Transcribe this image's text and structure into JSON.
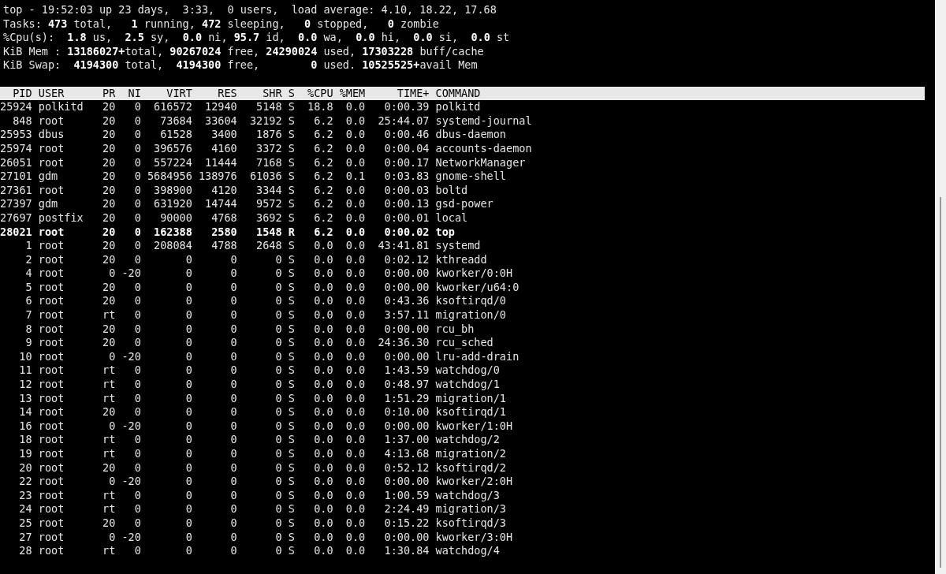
{
  "summary": [
    "top - 19:52:03 up 23 days,  3:33,  0 users,  load average: 4.10, 18.22, 17.68",
    "Tasks: **473** total,   **1** running, **472** sleeping,   **0** stopped,   **0** zombie",
    "%Cpu(s):  **1.8** us,  **2.5** sy,  **0.0** ni, **95.7** id,  **0.0** wa,  **0.0** hi,  **0.0** si,  **0.0** st",
    "KiB Mem : **13186027+**total, **90267024** free, **24290024** used, **17303228** buff/cache",
    "KiB Swap:  **4194300** total,  **4194300** free,        **0** used. **10525525+**avail Mem"
  ],
  "table": {
    "columns": [
      "PID",
      "USER",
      "PR",
      "NI",
      "VIRT",
      "RES",
      "SHR",
      "S",
      "%CPU",
      "%MEM",
      "TIME+",
      "COMMAND"
    ],
    "rows": [
      {
        "cells": [
          "25924",
          "polkitd",
          "20",
          "0",
          "616572",
          "12940",
          "5148",
          "S",
          "18.8",
          "0.0",
          "0:00.39",
          "polkitd"
        ],
        "highlighted": false
      },
      {
        "cells": [
          "848",
          "root",
          "20",
          "0",
          "73684",
          "33604",
          "32192",
          "S",
          "6.2",
          "0.0",
          "25:44.07",
          "systemd-journal"
        ],
        "highlighted": false
      },
      {
        "cells": [
          "25953",
          "dbus",
          "20",
          "0",
          "61528",
          "3400",
          "1876",
          "S",
          "6.2",
          "0.0",
          "0:00.46",
          "dbus-daemon"
        ],
        "highlighted": false
      },
      {
        "cells": [
          "25974",
          "root",
          "20",
          "0",
          "396576",
          "4160",
          "3372",
          "S",
          "6.2",
          "0.0",
          "0:00.04",
          "accounts-daemon"
        ],
        "highlighted": false
      },
      {
        "cells": [
          "26051",
          "root",
          "20",
          "0",
          "557224",
          "11444",
          "7168",
          "S",
          "6.2",
          "0.0",
          "0:00.17",
          "NetworkManager"
        ],
        "highlighted": false
      },
      {
        "cells": [
          "27101",
          "gdm",
          "20",
          "0",
          "5684956",
          "138976",
          "61036",
          "S",
          "6.2",
          "0.1",
          "0:03.83",
          "gnome-shell"
        ],
        "highlighted": false
      },
      {
        "cells": [
          "27361",
          "root",
          "20",
          "0",
          "398900",
          "4120",
          "3344",
          "S",
          "6.2",
          "0.0",
          "0:00.03",
          "boltd"
        ],
        "highlighted": false
      },
      {
        "cells": [
          "27397",
          "gdm",
          "20",
          "0",
          "631920",
          "14744",
          "9572",
          "S",
          "6.2",
          "0.0",
          "0:00.13",
          "gsd-power"
        ],
        "highlighted": false
      },
      {
        "cells": [
          "27697",
          "postfix",
          "20",
          "0",
          "90000",
          "4768",
          "3692",
          "S",
          "6.2",
          "0.0",
          "0:00.01",
          "local"
        ],
        "highlighted": false
      },
      {
        "cells": [
          "28021",
          "root",
          "20",
          "0",
          "162388",
          "2580",
          "1548",
          "R",
          "6.2",
          "0.0",
          "0:00.02",
          "top"
        ],
        "highlighted": true
      },
      {
        "cells": [
          "1",
          "root",
          "20",
          "0",
          "208084",
          "4788",
          "2648",
          "S",
          "0.0",
          "0.0",
          "43:41.81",
          "systemd"
        ],
        "highlighted": false
      },
      {
        "cells": [
          "2",
          "root",
          "20",
          "0",
          "0",
          "0",
          "0",
          "S",
          "0.0",
          "0.0",
          "0:02.12",
          "kthreadd"
        ],
        "highlighted": false
      },
      {
        "cells": [
          "4",
          "root",
          "0",
          "-20",
          "0",
          "0",
          "0",
          "S",
          "0.0",
          "0.0",
          "0:00.00",
          "kworker/0:0H"
        ],
        "highlighted": false
      },
      {
        "cells": [
          "5",
          "root",
          "20",
          "0",
          "0",
          "0",
          "0",
          "S",
          "0.0",
          "0.0",
          "0:00.00",
          "kworker/u64:0"
        ],
        "highlighted": false
      },
      {
        "cells": [
          "6",
          "root",
          "20",
          "0",
          "0",
          "0",
          "0",
          "S",
          "0.0",
          "0.0",
          "0:43.36",
          "ksoftirqd/0"
        ],
        "highlighted": false
      },
      {
        "cells": [
          "7",
          "root",
          "rt",
          "0",
          "0",
          "0",
          "0",
          "S",
          "0.0",
          "0.0",
          "3:57.11",
          "migration/0"
        ],
        "highlighted": false
      },
      {
        "cells": [
          "8",
          "root",
          "20",
          "0",
          "0",
          "0",
          "0",
          "S",
          "0.0",
          "0.0",
          "0:00.00",
          "rcu_bh"
        ],
        "highlighted": false
      },
      {
        "cells": [
          "9",
          "root",
          "20",
          "0",
          "0",
          "0",
          "0",
          "S",
          "0.0",
          "0.0",
          "24:36.30",
          "rcu_sched"
        ],
        "highlighted": false
      },
      {
        "cells": [
          "10",
          "root",
          "0",
          "-20",
          "0",
          "0",
          "0",
          "S",
          "0.0",
          "0.0",
          "0:00.00",
          "lru-add-drain"
        ],
        "highlighted": false
      },
      {
        "cells": [
          "11",
          "root",
          "rt",
          "0",
          "0",
          "0",
          "0",
          "S",
          "0.0",
          "0.0",
          "1:43.59",
          "watchdog/0"
        ],
        "highlighted": false
      },
      {
        "cells": [
          "12",
          "root",
          "rt",
          "0",
          "0",
          "0",
          "0",
          "S",
          "0.0",
          "0.0",
          "0:48.97",
          "watchdog/1"
        ],
        "highlighted": false
      },
      {
        "cells": [
          "13",
          "root",
          "rt",
          "0",
          "0",
          "0",
          "0",
          "S",
          "0.0",
          "0.0",
          "1:51.29",
          "migration/1"
        ],
        "highlighted": false
      },
      {
        "cells": [
          "14",
          "root",
          "20",
          "0",
          "0",
          "0",
          "0",
          "S",
          "0.0",
          "0.0",
          "0:10.00",
          "ksoftirqd/1"
        ],
        "highlighted": false
      },
      {
        "cells": [
          "16",
          "root",
          "0",
          "-20",
          "0",
          "0",
          "0",
          "S",
          "0.0",
          "0.0",
          "0:00.00",
          "kworker/1:0H"
        ],
        "highlighted": false
      },
      {
        "cells": [
          "18",
          "root",
          "rt",
          "0",
          "0",
          "0",
          "0",
          "S",
          "0.0",
          "0.0",
          "1:37.00",
          "watchdog/2"
        ],
        "highlighted": false
      },
      {
        "cells": [
          "19",
          "root",
          "rt",
          "0",
          "0",
          "0",
          "0",
          "S",
          "0.0",
          "0.0",
          "4:13.68",
          "migration/2"
        ],
        "highlighted": false
      },
      {
        "cells": [
          "20",
          "root",
          "20",
          "0",
          "0",
          "0",
          "0",
          "S",
          "0.0",
          "0.0",
          "0:52.12",
          "ksoftirqd/2"
        ],
        "highlighted": false
      },
      {
        "cells": [
          "22",
          "root",
          "0",
          "-20",
          "0",
          "0",
          "0",
          "S",
          "0.0",
          "0.0",
          "0:00.00",
          "kworker/2:0H"
        ],
        "highlighted": false
      },
      {
        "cells": [
          "23",
          "root",
          "rt",
          "0",
          "0",
          "0",
          "0",
          "S",
          "0.0",
          "0.0",
          "1:00.59",
          "watchdog/3"
        ],
        "highlighted": false
      },
      {
        "cells": [
          "24",
          "root",
          "rt",
          "0",
          "0",
          "0",
          "0",
          "S",
          "0.0",
          "0.0",
          "2:24.49",
          "migration/3"
        ],
        "highlighted": false
      },
      {
        "cells": [
          "25",
          "root",
          "20",
          "0",
          "0",
          "0",
          "0",
          "S",
          "0.0",
          "0.0",
          "0:15.22",
          "ksoftirqd/3"
        ],
        "highlighted": false
      },
      {
        "cells": [
          "27",
          "root",
          "0",
          "-20",
          "0",
          "0",
          "0",
          "S",
          "0.0",
          "0.0",
          "0:00.00",
          "kworker/3:0H"
        ],
        "highlighted": false
      },
      {
        "cells": [
          "28",
          "root",
          "rt",
          "0",
          "0",
          "0",
          "0",
          "S",
          "0.0",
          "0.0",
          "1:30.84",
          "watchdog/4"
        ],
        "highlighted": false
      }
    ]
  }
}
